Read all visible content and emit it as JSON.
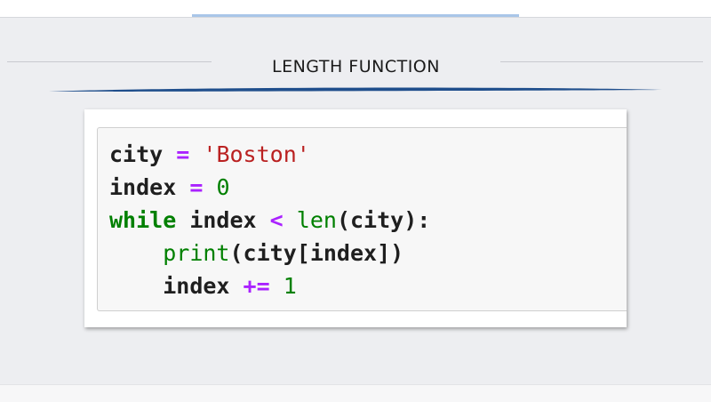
{
  "slide": {
    "title": "LENGTH FUNCTION"
  },
  "colors": {
    "background": "#edeef1",
    "title_swoosh": "#1f4e8c",
    "top_accent": "#a9c6e8",
    "code_name": "#1f1f1f",
    "code_operator": "#aa22ff",
    "code_string": "#ba2121",
    "code_number": "#008000",
    "code_keyword": "#008000"
  },
  "code": {
    "language": "python",
    "lines": [
      {
        "indent": "",
        "tokens": [
          {
            "type": "name",
            "text": "city"
          },
          {
            "type": "text",
            "text": " "
          },
          {
            "type": "op",
            "text": "="
          },
          {
            "type": "text",
            "text": " "
          },
          {
            "type": "str",
            "text": "'Boston'"
          }
        ]
      },
      {
        "indent": "",
        "tokens": [
          {
            "type": "name",
            "text": "index"
          },
          {
            "type": "text",
            "text": " "
          },
          {
            "type": "op",
            "text": "="
          },
          {
            "type": "text",
            "text": " "
          },
          {
            "type": "num",
            "text": "0"
          }
        ]
      },
      {
        "indent": "",
        "tokens": [
          {
            "type": "kw",
            "text": "while"
          },
          {
            "type": "text",
            "text": " "
          },
          {
            "type": "name",
            "text": "index"
          },
          {
            "type": "text",
            "text": " "
          },
          {
            "type": "op",
            "text": "<"
          },
          {
            "type": "text",
            "text": " "
          },
          {
            "type": "builtin",
            "text": "len"
          },
          {
            "type": "punc",
            "text": "("
          },
          {
            "type": "name",
            "text": "city"
          },
          {
            "type": "punc",
            "text": "):"
          }
        ]
      },
      {
        "indent": "    ",
        "tokens": [
          {
            "type": "builtin",
            "text": "print"
          },
          {
            "type": "punc",
            "text": "("
          },
          {
            "type": "name",
            "text": "city"
          },
          {
            "type": "punc",
            "text": "["
          },
          {
            "type": "name",
            "text": "index"
          },
          {
            "type": "punc",
            "text": "])"
          }
        ]
      },
      {
        "indent": "    ",
        "tokens": [
          {
            "type": "name",
            "text": "index"
          },
          {
            "type": "text",
            "text": " "
          },
          {
            "type": "op",
            "text": "+="
          },
          {
            "type": "text",
            "text": " "
          },
          {
            "type": "num",
            "text": "1"
          }
        ]
      }
    ]
  }
}
